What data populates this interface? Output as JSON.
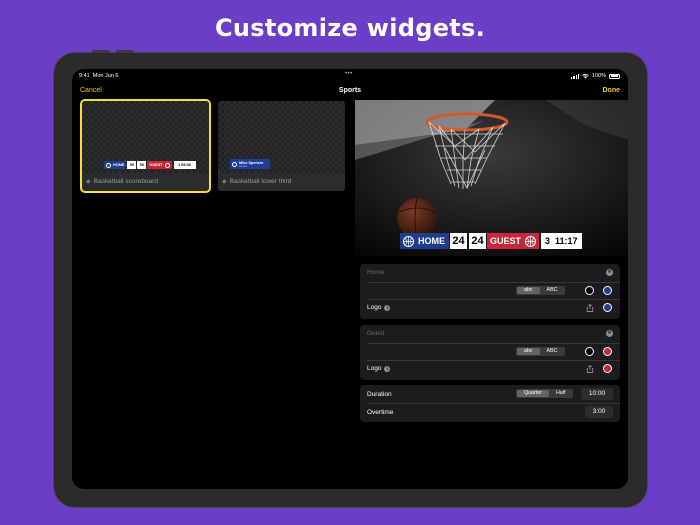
{
  "headline": "Customize widgets.",
  "status": {
    "time": "9:41",
    "date": "Mon Jun 6",
    "battery": "100%"
  },
  "nav": {
    "cancel": "Cancel",
    "title": "Sports",
    "done": "Done"
  },
  "templates": [
    {
      "caption": "Basketball scoreboard",
      "selected": true
    },
    {
      "caption": "Basketball lower third",
      "selected": false
    }
  ],
  "mini_scoreboard": {
    "home": "HOME",
    "home_score": "00",
    "guest_score": "00",
    "guest": "GUEST",
    "clock": "09:00"
  },
  "mini_lower": {
    "name": "Mike Spencer",
    "subtitle": "Guard"
  },
  "preview": {
    "home_label": "HOME",
    "home_score": "24",
    "guest_score": "24",
    "guest_label": "GUEST",
    "period": "3",
    "clock": "11:17"
  },
  "home_team": {
    "placeholder": "Home",
    "case_options": [
      "abc",
      "ABC"
    ],
    "case_selected": "abc",
    "logo_label": "Logo",
    "color": "#1f3c8e"
  },
  "guest_team": {
    "placeholder": "Guest",
    "case_options": [
      "abc",
      "ABC"
    ],
    "case_selected": "abc",
    "logo_label": "Logo",
    "color": "#c7273a"
  },
  "timing": {
    "duration_label": "Duration",
    "duration_options": [
      "Quarter",
      "Half"
    ],
    "duration_selected": "Quarter",
    "duration_value": "10:00",
    "overtime_label": "Overtime",
    "overtime_value": "3:00"
  },
  "colors": {
    "accent": "#f4c430",
    "background": "#6a3ec6",
    "home": "#1f3c8e",
    "guest": "#c7273a"
  }
}
